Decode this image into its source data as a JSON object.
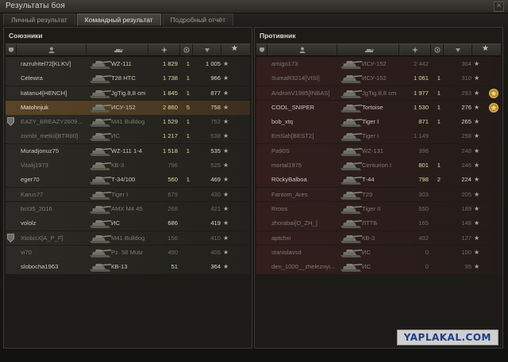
{
  "window": {
    "title": "Результаты боя",
    "close_glyph": "×"
  },
  "tabs": [
    {
      "label": "Личный результат",
      "active": false
    },
    {
      "label": "Командный результат",
      "active": true
    },
    {
      "label": "Подробный отчёт",
      "active": false
    }
  ],
  "allies": {
    "title": "Союзники",
    "rows": [
      {
        "name": "razruhitel72[KLKV]",
        "vehicle": "WZ-111",
        "damage": "1 829",
        "kills": "1",
        "xp": "1 005",
        "state": "alive",
        "icon": "tank-icon"
      },
      {
        "name": "Celewra",
        "vehicle": "T28 HTC",
        "damage": "1 738",
        "kills": "1",
        "xp": "966",
        "state": "alive",
        "icon": "tank-icon"
      },
      {
        "name": "katanu4[HENCH]",
        "vehicle": "JgTig.8,8 cm",
        "damage": "1 845",
        "kills": "1",
        "xp": "877",
        "state": "alive",
        "icon": "tank-icon"
      },
      {
        "name": "Matohnjuk",
        "vehicle": "ИСУ-152",
        "damage": "2 860",
        "kills": "5",
        "xp": "758",
        "state": "self",
        "icon": "tank-icon"
      },
      {
        "name": "EAZY_BREAZY2609...",
        "vehicle": "M41 Bulldog",
        "damage": "1 529",
        "kills": "1",
        "xp": "752",
        "state": "dead",
        "platoon": true,
        "icon": "tank-icon"
      },
      {
        "name": "zombi_metkii[BTR80]",
        "vehicle": "ИС",
        "damage": "1 217",
        "kills": "1",
        "xp": "538",
        "state": "dead",
        "icon": "tank-icon"
      },
      {
        "name": "Muradjonuz75",
        "vehicle": "WZ-111 1-4",
        "damage": "1 518",
        "kills": "1",
        "xp": "535",
        "state": "alive",
        "icon": "tank-icon"
      },
      {
        "name": "Vitalij1973",
        "vehicle": "КВ-3",
        "damage": "796",
        "kills": "",
        "xp": "525",
        "state": "dead",
        "icon": "tank-icon"
      },
      {
        "name": "eger70",
        "vehicle": "Т-34/100",
        "damage": "560",
        "kills": "1",
        "xp": "469",
        "state": "alive",
        "icon": "tank-icon"
      },
      {
        "name": "Karus77",
        "vehicle": "Tiger I",
        "damage": "679",
        "kills": "",
        "xp": "430",
        "state": "dead",
        "icon": "tank-icon"
      },
      {
        "name": "bct35_2016",
        "vehicle": "AMX M4 45",
        "damage": "268",
        "kills": "",
        "xp": "421",
        "state": "dead",
        "icon": "tank-icon"
      },
      {
        "name": "vololz",
        "vehicle": "ИС",
        "damage": "686",
        "kills": "",
        "xp": "419",
        "state": "alive",
        "icon": "tank-icon"
      },
      {
        "name": "XtobisX[A_P_F]",
        "vehicle": "M41 Bulldog",
        "damage": "156",
        "kills": "",
        "xp": "410",
        "state": "dead",
        "platoon": true,
        "icon": "tank-icon"
      },
      {
        "name": "vi70",
        "vehicle": "Pz. 58 Mutz",
        "damage": "490",
        "kills": "",
        "xp": "406",
        "state": "dead",
        "icon": "tank-icon"
      },
      {
        "name": "slobocha1963",
        "vehicle": "КВ-13",
        "damage": "51",
        "kills": "",
        "xp": "364",
        "state": "alive",
        "icon": "tank-icon"
      }
    ]
  },
  "enemies": {
    "title": "Противник",
    "rows": [
      {
        "name": "amigo173",
        "vehicle": "ИСУ-152",
        "damage": "2 442",
        "kills": "",
        "xp": "364",
        "state": "dead",
        "icon": "tank-icon"
      },
      {
        "name": "SumaR3214[VISI]",
        "vehicle": "ИСУ-152",
        "damage": "1 061",
        "kills": "1",
        "xp": "310",
        "state": "dead",
        "icon": "tank-icon"
      },
      {
        "name": "AndronV1985[INBAS]",
        "vehicle": "JgTig.8,8 cm",
        "damage": "1 977",
        "kills": "1",
        "xp": "293",
        "state": "dead",
        "medal": true,
        "icon": "tank-icon"
      },
      {
        "name": "COOL_SNIPER",
        "vehicle": "Tortoise",
        "damage": "1 530",
        "kills": "1",
        "xp": "276",
        "state": "alive",
        "medal": true,
        "icon": "tank-icon"
      },
      {
        "name": "bob_xtq",
        "vehicle": "Tiger I",
        "damage": "871",
        "kills": "1",
        "xp": "265",
        "state": "alive",
        "icon": "tank-icon"
      },
      {
        "name": "EmSah[BEST2]",
        "vehicle": "Tiger I",
        "damage": "1 149",
        "kills": "",
        "xp": "258",
        "state": "dead",
        "icon": "tank-icon"
      },
      {
        "name": "Pa90S",
        "vehicle": "WZ-131",
        "damage": "396",
        "kills": "",
        "xp": "248",
        "state": "dead",
        "icon": "tank-icon"
      },
      {
        "name": "mortal1975",
        "vehicle": "Centurion I",
        "damage": "801",
        "kills": "1",
        "xp": "246",
        "state": "dead",
        "icon": "tank-icon"
      },
      {
        "name": "R0ckyBalboa",
        "vehicle": "Т-44",
        "damage": "798",
        "kills": "2",
        "xp": "224",
        "state": "alive",
        "icon": "tank-icon"
      },
      {
        "name": "Fantom_Ares",
        "vehicle": "T29",
        "damage": "303",
        "kills": "",
        "xp": "205",
        "state": "dead",
        "icon": "tank-icon"
      },
      {
        "name": "Rroos",
        "vehicle": "Tiger II",
        "damage": "650",
        "kills": "",
        "xp": "189",
        "state": "dead",
        "icon": "tank-icon"
      },
      {
        "name": "zhorabai[O_ZH_]",
        "vehicle": "ЛТТБ",
        "damage": "165",
        "kills": "",
        "xp": "148",
        "state": "dead",
        "icon": "tank-icon"
      },
      {
        "name": "aptchxi",
        "vehicle": "КВ-3",
        "damage": "402",
        "kills": "",
        "xp": "127",
        "state": "dead",
        "icon": "tank-icon"
      },
      {
        "name": "stanislavsd",
        "vehicle": "ИС",
        "damage": "0",
        "kills": "",
        "xp": "100",
        "state": "dead",
        "icon": "tank-icon"
      },
      {
        "name": "den_1000__zheleznyi...",
        "vehicle": "ИС",
        "damage": "0",
        "kills": "",
        "xp": "95",
        "state": "dead",
        "icon": "tank-icon"
      }
    ]
  },
  "watermark": "YAPLAKAL.COM",
  "colors": {
    "ally_row": "#2b2a26",
    "enemy_row": "#331e1c",
    "self_row": "#5a4427",
    "accent": "#e0d9a7"
  }
}
